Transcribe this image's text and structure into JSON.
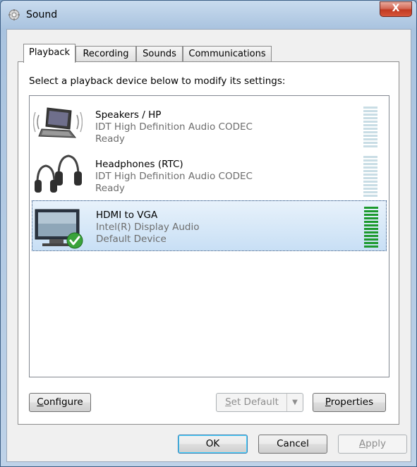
{
  "window": {
    "title": "Sound",
    "close_label": "X"
  },
  "tabs": [
    {
      "label": "Playback",
      "active": true
    },
    {
      "label": "Recording",
      "active": false
    },
    {
      "label": "Sounds",
      "active": false
    },
    {
      "label": "Communications",
      "active": false
    }
  ],
  "instruction": "Select a playback device below to modify its settings:",
  "devices": [
    {
      "name": "Speakers / HP",
      "driver": "IDT High Definition Audio CODEC",
      "status": "Ready",
      "icon": "laptop-speakers-icon",
      "level": 0
    },
    {
      "name": "Headphones (RTC)",
      "driver": "IDT High Definition Audio CODEC",
      "status": "Ready",
      "icon": "headphones-icon",
      "level": 0
    },
    {
      "name": "HDMI to VGA",
      "driver": "Intel(R) Display Audio",
      "status": "Default Device",
      "icon": "monitor-icon",
      "level": 1.0,
      "selected": true,
      "default_badge": "check-icon"
    }
  ],
  "buttons": {
    "configure": "Configure",
    "set_default": "Set Default",
    "properties": "Properties",
    "ok": "OK",
    "cancel": "Cancel",
    "apply": "Apply"
  },
  "colors": {
    "meter_active": "#1c9a2e",
    "meter_idle": "#c9dde5",
    "selection": "#c8dff5"
  }
}
